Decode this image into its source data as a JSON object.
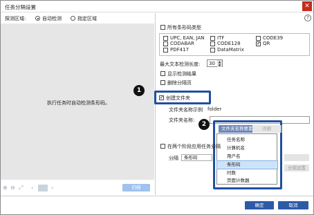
{
  "window": {
    "title": "任务分隔设置",
    "close_icon": "✕"
  },
  "mode": {
    "label": "探测区域:",
    "auto": "自动检测",
    "specify": "指定区域"
  },
  "preview": {
    "message": "执行任务时自动检测条形码。",
    "scan_button": "扫描"
  },
  "barcode": {
    "all_types_label": "所有条形码类型",
    "types": [
      {
        "label": "UPC, EAN, JAN",
        "checked": false
      },
      {
        "label": "ITF",
        "checked": false
      },
      {
        "label": "CODE39",
        "checked": false
      },
      {
        "label": "CODABAR",
        "checked": false
      },
      {
        "label": "CODE128",
        "checked": false
      },
      {
        "label": "QR",
        "checked": true
      },
      {
        "label": "PDF417",
        "checked": false
      },
      {
        "label": "DataMatrix",
        "checked": false
      }
    ],
    "max_length_label": "最大文本检测长度:",
    "max_length_value": "30",
    "show_results_label": "显示检测结果",
    "delete_partial_label": "删除分隔页"
  },
  "folder": {
    "create_label": "创建文件夹",
    "example_label": "文件夹名称示例",
    "example_value": "folder",
    "name_label": "文件夹名称:",
    "dropdown_label": "文件夹名称要素",
    "detail_button": "详细",
    "menu_items": [
      "任务名称",
      "计算机名",
      "用户名",
      "条形码",
      "时数",
      "页面计数器"
    ],
    "selected_index": 3
  },
  "apply": {
    "label": "在两个阶段应用任务分隔",
    "split_label": "分隔",
    "split_value": "条形码",
    "settings_button": "分隔设置"
  },
  "footer": {
    "ok": "确定",
    "cancel": "取消"
  },
  "annotations": {
    "step1": "1",
    "step2": "2"
  },
  "icons": {
    "help": "?"
  }
}
